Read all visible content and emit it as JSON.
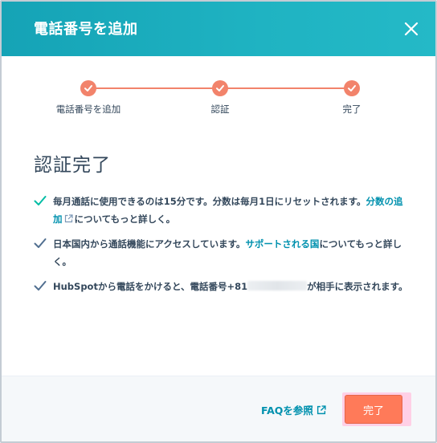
{
  "dialog": {
    "title": "電話番号を追加"
  },
  "steps": [
    {
      "label": "電話番号を追加"
    },
    {
      "label": "認証"
    },
    {
      "label": "完了"
    }
  ],
  "main": {
    "heading": "認証完了",
    "items": [
      {
        "text_before": "毎月通話に使用できるのは15分です。分数は毎月1日にリセットされます。",
        "link": "分数の追加",
        "text_after": "についてもっと詳しく。"
      },
      {
        "text_before": "日本国内から通話機能にアクセスしています。",
        "link": "サポートされる国",
        "text_after": "についてもっと詳しく。"
      },
      {
        "text_before": "HubSpotから電話をかけると、電話番号+81",
        "text_after": "が相手に表示されます。"
      }
    ]
  },
  "footer": {
    "faq_label": "FAQを参照",
    "done_label": "完了"
  },
  "colors": {
    "header": "#1fb3c2",
    "step": "#f2836b",
    "check": "#00bda5",
    "link": "#0091ae",
    "primary_button": "#ff7a59"
  }
}
